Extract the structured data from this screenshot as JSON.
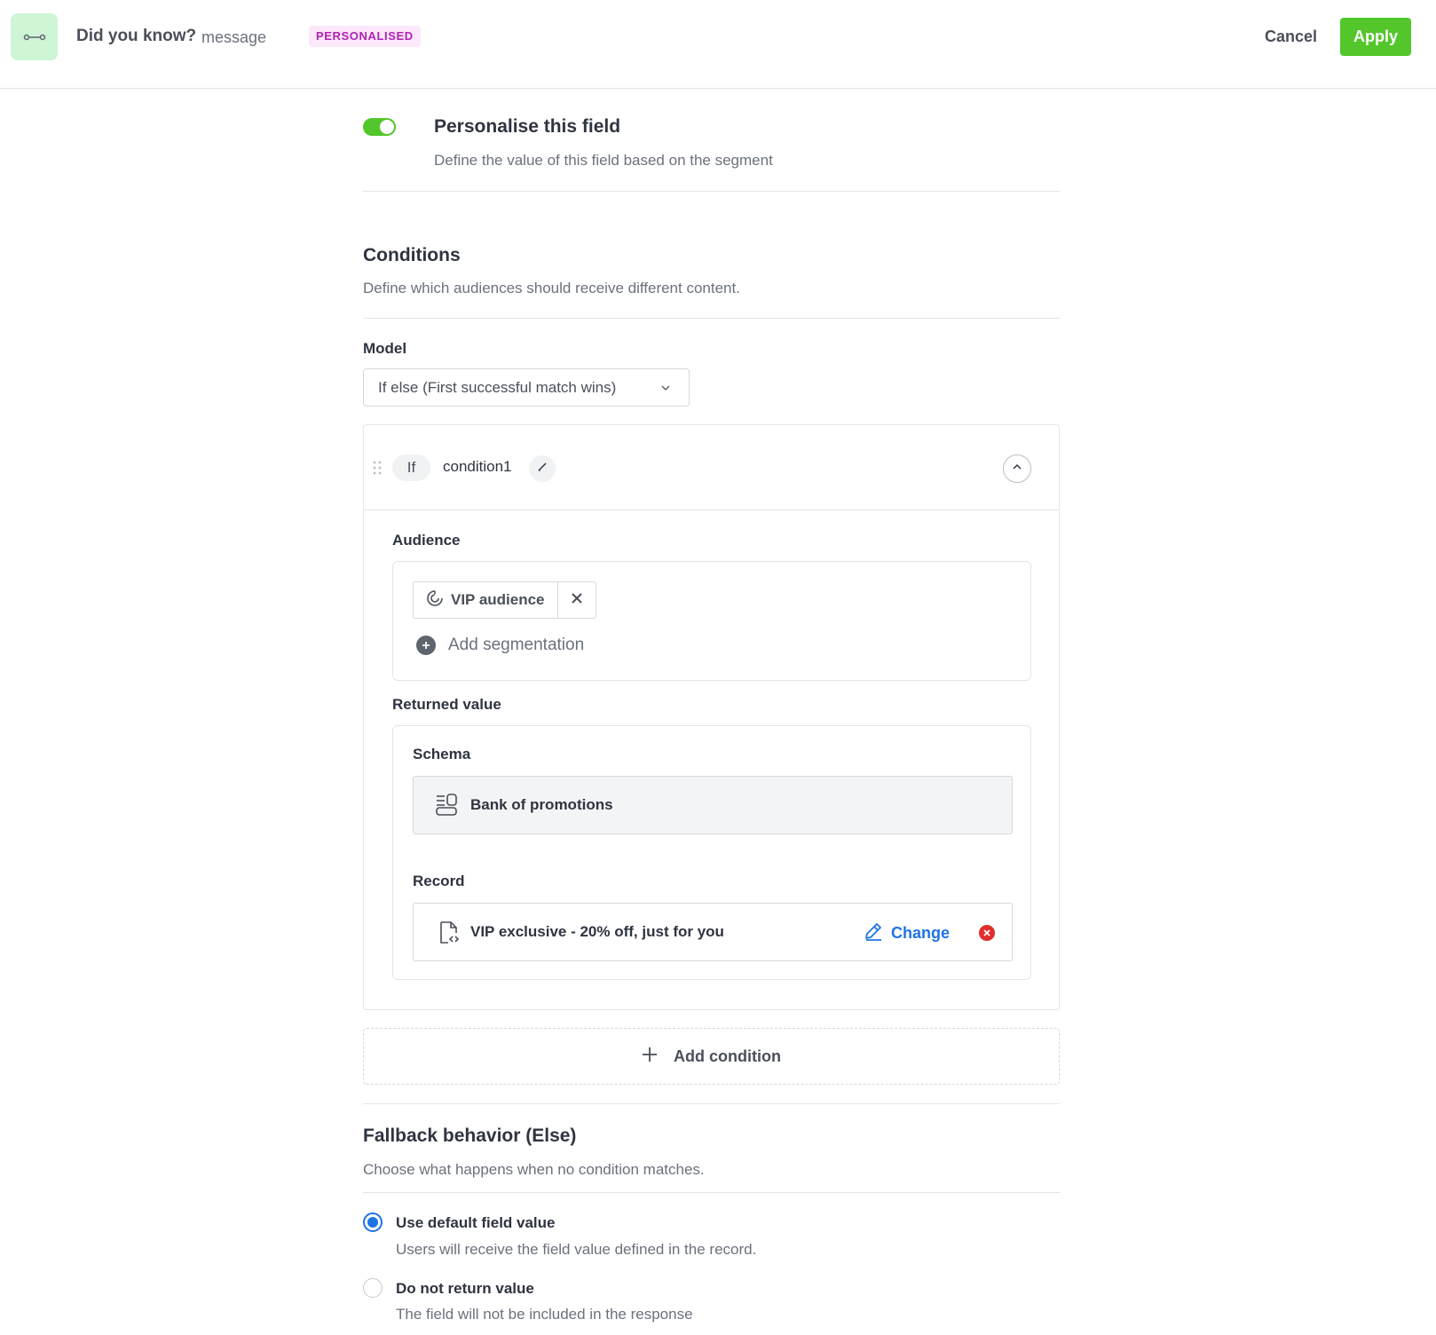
{
  "header": {
    "title": "Did you know?",
    "subtitle": "message",
    "badge": "PERSONALISED",
    "cancel_label": "Cancel",
    "apply_label": "Apply",
    "app_icon": "connector-icon"
  },
  "personalise": {
    "enabled": true,
    "title": "Personalise this field",
    "description": "Define the value of this field based on the segment"
  },
  "conditions": {
    "title": "Conditions",
    "description": "Define which audiences should receive different content.",
    "model_label": "Model",
    "model_value": "If else (First successful match wins)",
    "items": [
      {
        "keyword": "If",
        "name": "condition1",
        "audience_label": "Audience",
        "audience_chip": "VIP audience",
        "add_segmentation_label": "Add segmentation",
        "returned_value_label": "Returned value",
        "schema_label": "Schema",
        "schema_value": "Bank of promotions",
        "record_label": "Record",
        "record_value": "VIP exclusive - 20% off, just for you",
        "change_label": "Change"
      }
    ],
    "add_condition_label": "Add condition"
  },
  "fallback": {
    "title": "Fallback behavior (Else)",
    "description": "Choose what happens when no condition matches.",
    "options": [
      {
        "label": "Use default field value",
        "description": "Users will receive the field value defined in the record.",
        "selected": true
      },
      {
        "label": "Do not return value",
        "description": "The field will not be included in the response",
        "selected": false
      }
    ]
  },
  "colors": {
    "accent_green": "#53c62b",
    "link_blue": "#1f74e5",
    "badge_purple": "#b022b5",
    "danger_red": "#e02d2d"
  }
}
